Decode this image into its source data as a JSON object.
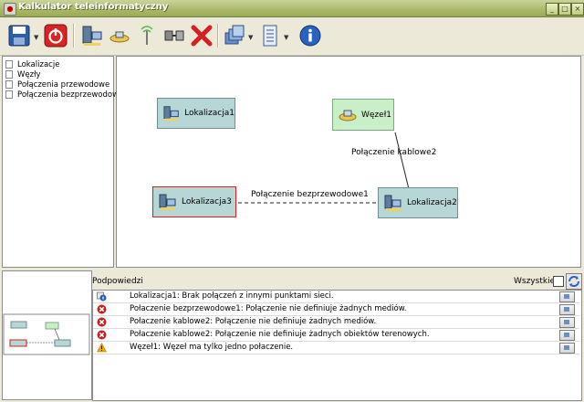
{
  "window": {
    "title": "Kalkulator teleinformatyczny",
    "app_icon": "app-icon",
    "controls": [
      "minimize",
      "maximize",
      "close"
    ]
  },
  "toolbar": {
    "buttons": [
      {
        "name": "save-icon",
        "has_dropdown": true
      },
      {
        "name": "power-icon",
        "has_dropdown": false
      },
      {
        "name": "add-location-icon",
        "has_dropdown": false
      },
      {
        "name": "add-node-icon",
        "has_dropdown": false
      },
      {
        "name": "add-wireless-connection-icon",
        "has_dropdown": false
      },
      {
        "name": "add-wired-connection-icon",
        "has_dropdown": false
      },
      {
        "name": "delete-icon",
        "has_dropdown": false
      },
      {
        "name": "layers-icon",
        "has_dropdown": true
      },
      {
        "name": "list-icon",
        "has_dropdown": true
      },
      {
        "name": "info-icon",
        "has_dropdown": false
      }
    ]
  },
  "tree": {
    "items": [
      "Lokalizacje",
      "Węzły",
      "Połączenia przewodowe",
      "Połączenia bezprzewodowe"
    ]
  },
  "diagram": {
    "nodes": [
      {
        "label": "Lokalizacja1",
        "type": "location"
      },
      {
        "label": "Węzeł1",
        "type": "node"
      },
      {
        "label": "Lokalizacja3",
        "type": "location",
        "selected": true
      },
      {
        "label": "Lokalizacja2",
        "type": "location"
      }
    ],
    "edges": [
      {
        "label": "Połączenie kablowe2",
        "from": "Węzeł1",
        "to": "Lokalizacja2",
        "style": "solid"
      },
      {
        "label": "Połączenie bezprzewodowe1",
        "from": "Lokalizacja3",
        "to": "Lokalizacja2",
        "style": "dashed"
      }
    ]
  },
  "colors": {
    "location_fill": "#b7d6d6",
    "node_fill": "#c9efc9",
    "selected_border": "#d22020",
    "error": "#c81e1e",
    "warning": "#f2a900",
    "info": "#2a5db0"
  },
  "hints": {
    "title": "Podpowiedzi",
    "all_label": "Wszystkie:",
    "all_checked": false,
    "items": [
      {
        "severity": "info",
        "icon": "info-icon",
        "text": "Lokalizacja1: Brak połączeń z innymi punktami sieci."
      },
      {
        "severity": "error",
        "icon": "error-icon",
        "text": "Połaczenie bezprzewodowe1: Połączenie nie definiuje żadnych mediów."
      },
      {
        "severity": "error",
        "icon": "error-icon",
        "text": "Połaczenie kablowe2: Połączenie nie definiuje żadnych mediów."
      },
      {
        "severity": "error",
        "icon": "error-icon",
        "text": "Połaczenie kablowe2: Połączenie nie definiuje żadnych obiektów terenowych."
      },
      {
        "severity": "warning",
        "icon": "warning-icon",
        "text": "Węzeł1: Węzeł ma tylko jedno połaczenie."
      }
    ]
  }
}
